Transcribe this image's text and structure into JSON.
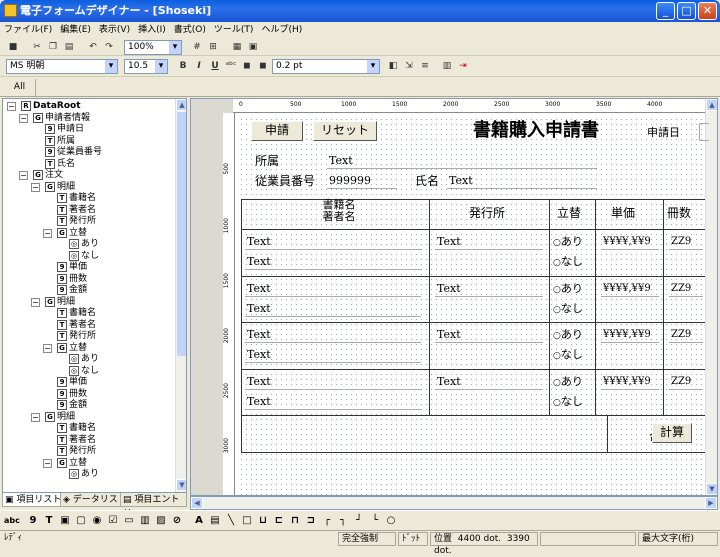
{
  "window": {
    "title": "電子フォームデザイナー - [Shoseki]",
    "minimize": "_",
    "maximize": "□",
    "close": "✕"
  },
  "menu": [
    "ファイル(F)",
    "編集(E)",
    "表示(V)",
    "挿入(I)",
    "書式(O)",
    "ツール(T)",
    "ヘルプ(H)"
  ],
  "toolbar1": {
    "zoom": "100%"
  },
  "toolbar2": {
    "font": "MS 明朝",
    "size": "10.5",
    "bold": "B",
    "italic": "I",
    "underline": "U",
    "linewidth": "0.2 pt"
  },
  "tabs": {
    "all": "All"
  },
  "tree": [
    {
      "d": 0,
      "t": "DataRoot",
      "i": "R",
      "bold": true,
      "exp": "−"
    },
    {
      "d": 1,
      "t": "申請者情報",
      "i": "G",
      "exp": "−"
    },
    {
      "d": 2,
      "t": "申請日",
      "i": "9"
    },
    {
      "d": 2,
      "t": "所属",
      "i": "T"
    },
    {
      "d": 2,
      "t": "従業員番号",
      "i": "9"
    },
    {
      "d": 2,
      "t": "氏名",
      "i": "T"
    },
    {
      "d": 1,
      "t": "注文",
      "i": "G",
      "exp": "−"
    },
    {
      "d": 2,
      "t": "明細",
      "i": "G",
      "exp": "−"
    },
    {
      "d": 3,
      "t": "書籍名",
      "i": "T"
    },
    {
      "d": 3,
      "t": "著者名",
      "i": "T"
    },
    {
      "d": 3,
      "t": "発行所",
      "i": "T"
    },
    {
      "d": 3,
      "t": "立替",
      "i": "G",
      "exp": "−"
    },
    {
      "d": 4,
      "t": "あり",
      "i": "◎"
    },
    {
      "d": 4,
      "t": "なし",
      "i": "◎"
    },
    {
      "d": 3,
      "t": "単価",
      "i": "9"
    },
    {
      "d": 3,
      "t": "冊数",
      "i": "9"
    },
    {
      "d": 3,
      "t": "金額",
      "i": "9"
    },
    {
      "d": 2,
      "t": "明細",
      "i": "G",
      "exp": "−"
    },
    {
      "d": 3,
      "t": "書籍名",
      "i": "T"
    },
    {
      "d": 3,
      "t": "著者名",
      "i": "T"
    },
    {
      "d": 3,
      "t": "発行所",
      "i": "T"
    },
    {
      "d": 3,
      "t": "立替",
      "i": "G",
      "exp": "−"
    },
    {
      "d": 4,
      "t": "あり",
      "i": "◎"
    },
    {
      "d": 4,
      "t": "なし",
      "i": "◎"
    },
    {
      "d": 3,
      "t": "単価",
      "i": "9"
    },
    {
      "d": 3,
      "t": "冊数",
      "i": "9"
    },
    {
      "d": 3,
      "t": "金額",
      "i": "9"
    },
    {
      "d": 2,
      "t": "明細",
      "i": "G",
      "exp": "−"
    },
    {
      "d": 3,
      "t": "書籍名",
      "i": "T"
    },
    {
      "d": 3,
      "t": "著者名",
      "i": "T"
    },
    {
      "d": 3,
      "t": "発行所",
      "i": "T"
    },
    {
      "d": 3,
      "t": "立替",
      "i": "G",
      "exp": "−"
    },
    {
      "d": 4,
      "t": "あり",
      "i": "◎"
    }
  ],
  "treetabs": [
    "項目リスト",
    "データリスト",
    "項目エントリ"
  ],
  "ruler": {
    "top": [
      "0",
      "500",
      "1000",
      "1500",
      "2000",
      "2500",
      "3000",
      "3500",
      "4000"
    ],
    "left": [
      "500",
      "1000",
      "1500",
      "2000",
      "2500",
      "3000"
    ]
  },
  "form": {
    "apply_button": "申請",
    "reset_button": "リセット",
    "title": "書籍購入申請書",
    "date_label": "申請日",
    "dept_label": "所属",
    "dept_value": "Text",
    "empno_label": "従業員番号",
    "empno_value": "999999",
    "name_label": "氏名",
    "name_value": "Text",
    "headers": {
      "book_line1": "書籍名",
      "book_line2": "著者名",
      "publisher": "発行所",
      "advance": "立替",
      "price": "単価",
      "qty": "冊数"
    },
    "rows": [
      {
        "book": "Text",
        "author": "Text",
        "publisher": "Text",
        "yes": "あり",
        "no": "なし",
        "price": "¥¥¥¥,¥¥9",
        "qty": "ZZ9"
      },
      {
        "book": "Text",
        "author": "Text",
        "publisher": "Text",
        "yes": "あり",
        "no": "なし",
        "price": "¥¥¥¥,¥¥9",
        "qty": "ZZ9"
      },
      {
        "book": "Text",
        "author": "Text",
        "publisher": "Text",
        "yes": "あり",
        "no": "なし",
        "price": "¥¥¥¥,¥¥9",
        "qty": "ZZ9"
      },
      {
        "book": "Text",
        "author": "Text",
        "publisher": "Text",
        "yes": "あり",
        "no": "なし",
        "price": "¥¥¥¥,¥¥9",
        "qty": "ZZ9"
      }
    ],
    "total_label": "合計",
    "calc_button": "計算"
  },
  "status": {
    "ready": "ﾚﾃﾞｨ",
    "snap": "完全強制",
    "unit": "ﾄﾞｯﾄ",
    "pos_label": "位置",
    "pos_x": "4400 dot.",
    "pos_y": "3390 dot.",
    "maxchars": "最大文字(桁)"
  }
}
